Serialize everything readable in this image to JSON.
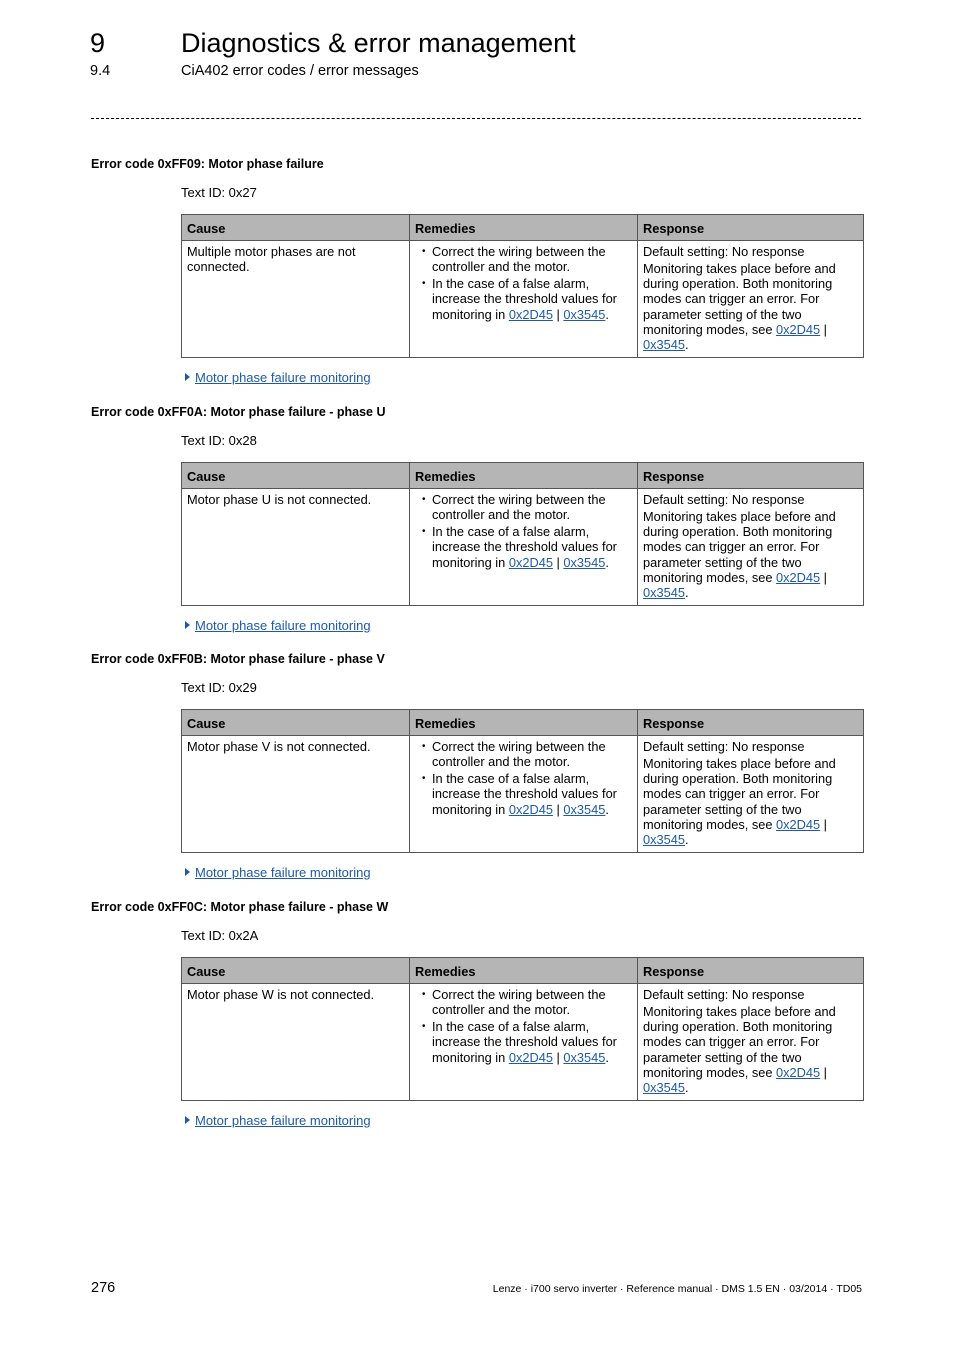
{
  "header": {
    "chapter_number": "9",
    "chapter_title": "Diagnostics & error management",
    "section_number": "9.4",
    "section_title": "CiA402 error codes / error messages"
  },
  "table_headers": [
    "Cause",
    "Remedies",
    "Response"
  ],
  "sections": [
    {
      "heading": "Error code 0xFF09: Motor phase failure",
      "text_id": "Text ID: 0x27",
      "cause": "Multiple motor phases are not connected.",
      "remedies": {
        "item1": "Correct the wiring between the controller and the motor.",
        "item2_prefix": "In the case of a false alarm, increase the threshold values for monitoring in ",
        "link1": "0x2D45",
        "sep": " | ",
        "link2": "0x3545",
        "suffix": "."
      },
      "response": {
        "line1": "Default setting: No response",
        "text": "Monitoring takes place before and during operation. Both monitoring modes can trigger an error. For parameter setting of the two monitoring modes, see ",
        "link1": "0x2D45",
        "sep": " | ",
        "link2": "0x3545",
        "suffix": "."
      },
      "see_also": "Motor phase failure monitoring"
    },
    {
      "heading": "Error code 0xFF0A: Motor phase failure - phase U",
      "text_id": "Text ID: 0x28",
      "cause": "Motor phase U is not connected.",
      "remedies": {
        "item1": "Correct the wiring between the controller and the motor.",
        "item2_prefix": "In the case of a false alarm, increase the threshold values for monitoring in ",
        "link1": "0x2D45",
        "sep": " | ",
        "link2": "0x3545",
        "suffix": "."
      },
      "response": {
        "line1": "Default setting: No response",
        "text": "Monitoring takes place before and during operation. Both monitoring modes can trigger an error. For parameter setting of the two monitoring modes, see ",
        "link1": "0x2D45",
        "sep": " | ",
        "link2": "0x3545",
        "suffix": "."
      },
      "see_also": "Motor phase failure monitoring"
    },
    {
      "heading": "Error code 0xFF0B: Motor phase failure - phase V",
      "text_id": "Text ID: 0x29",
      "cause": "Motor phase V is not connected.",
      "remedies": {
        "item1": "Correct the wiring between the controller and the motor.",
        "item2_prefix": "In the case of a false alarm, increase the threshold values for monitoring in ",
        "link1": "0x2D45",
        "sep": " | ",
        "link2": "0x3545",
        "suffix": "."
      },
      "response": {
        "line1": "Default setting: No response",
        "text": "Monitoring takes place before and during operation. Both monitoring modes can trigger an error. For parameter setting of the two monitoring modes, see ",
        "link1": "0x2D45",
        "sep": " | ",
        "link2": "0x3545",
        "suffix": "."
      },
      "see_also": "Motor phase failure monitoring"
    },
    {
      "heading": "Error code 0xFF0C: Motor phase failure - phase W",
      "text_id": "Text ID: 0x2A",
      "cause": "Motor phase W is not connected.",
      "remedies": {
        "item1": "Correct the wiring between the controller and the motor.",
        "item2_prefix": "In the case of a false alarm, increase the threshold values for monitoring in ",
        "link1": "0x2D45",
        "sep": " | ",
        "link2": "0x3545",
        "suffix": "."
      },
      "response": {
        "line1": "Default setting: No response",
        "text": "Monitoring takes place before and during operation. Both monitoring modes can trigger an error. For parameter setting of the two monitoring modes, see ",
        "link1": "0x2D45",
        "sep": " | ",
        "link2": "0x3545",
        "suffix": "."
      },
      "see_also": "Motor phase failure monitoring"
    }
  ],
  "footer": {
    "page_number": "276",
    "info": "Lenze · i700 servo inverter · Reference manual · DMS 1.5 EN · 03/2014 · TD05"
  },
  "colors": {
    "link": "#1d5aa8",
    "table_header_bg": "#b5b5b5",
    "border": "#555555"
  }
}
